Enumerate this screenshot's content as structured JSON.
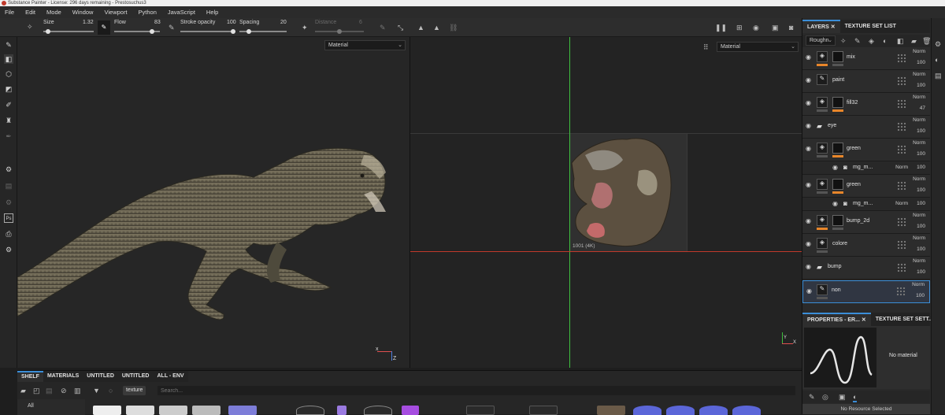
{
  "window": {
    "title": "Substance Painter - License: 296 days remaining - Prestosuchus3"
  },
  "menu": [
    "File",
    "Edit",
    "Mode",
    "Window",
    "Viewport",
    "Python",
    "JavaScript",
    "Help"
  ],
  "toolbar": {
    "size_label": "Size",
    "size_value": "1.32",
    "size_level": 0.1,
    "flow_label": "Flow",
    "flow_value": "83",
    "flow_level": 0.83,
    "stroke_opacity_label": "Stroke opacity",
    "stroke_opacity_value": "100",
    "stroke_opacity_level": 1.0,
    "spacing_label": "Spacing",
    "spacing_value": "20",
    "spacing_level": 0.2,
    "distance_label": "Distance",
    "distance_value": "6",
    "distance_level": 0.5
  },
  "viewports": {
    "left_mode": "Material",
    "right_mode": "Material",
    "uv_tile_label": "1001 (4K)"
  },
  "layers_panel": {
    "tabs": [
      "LAYERS",
      "TEXTURE SET LIST"
    ],
    "channel": "Roughn",
    "layers": [
      {
        "name": "mix",
        "type": "fill",
        "blend": "Norm",
        "opacity": "100",
        "has_mask": true,
        "accent": "#e8862a"
      },
      {
        "name": "paint",
        "type": "paint",
        "blend": "Norm",
        "opacity": "100",
        "has_mask": false,
        "accent": ""
      },
      {
        "name": "fill32",
        "type": "fill",
        "blend": "Norm",
        "opacity": "47",
        "has_mask": true,
        "accent": "#e8862a"
      },
      {
        "name": "eye",
        "type": "folder",
        "blend": "Norm",
        "opacity": "100",
        "has_mask": false,
        "accent": ""
      },
      {
        "name": "green",
        "type": "fill",
        "blend": "Norm",
        "opacity": "100",
        "has_mask": true,
        "accent": "#e8862a"
      },
      {
        "name": "mg_m...",
        "type": "sub",
        "blend": "Norm",
        "opacity": "100",
        "has_mask": false,
        "accent": ""
      },
      {
        "name": "green",
        "type": "fill",
        "blend": "Norm",
        "opacity": "100",
        "has_mask": true,
        "accent": "#e8862a"
      },
      {
        "name": "mg_m...",
        "type": "sub",
        "blend": "Norm",
        "opacity": "100",
        "has_mask": false,
        "accent": ""
      },
      {
        "name": "bump_2d",
        "type": "fill",
        "blend": "Norm",
        "opacity": "100",
        "has_mask": true,
        "accent": "#e8862a"
      },
      {
        "name": "colore",
        "type": "fill",
        "blend": "Norm",
        "opacity": "100",
        "has_mask": false,
        "accent": ""
      },
      {
        "name": "bump",
        "type": "folder",
        "blend": "Norm",
        "opacity": "100",
        "has_mask": false,
        "accent": ""
      },
      {
        "name": "non",
        "type": "paint",
        "blend": "Norm",
        "opacity": "100",
        "has_mask": false,
        "accent": "",
        "selected": true
      }
    ]
  },
  "properties_panel": {
    "tabs": [
      "PROPERTIES - ER...",
      "TEXTURE SET SETT..."
    ],
    "material_text": "No material",
    "footer_text": "No Resource Selected"
  },
  "shelf": {
    "tabs": [
      "SHELF",
      "MATERIALS",
      "UNTITLED",
      "UNTITLED",
      "ALL - ENV"
    ],
    "filter_tag": "texture",
    "search_placeholder": "Search...",
    "category": "All"
  },
  "colors": {
    "accent_blue": "#3b8ed8",
    "layer_accent_orange": "#e8862a",
    "uv_green": "#3fbf3f",
    "uv_red": "#c0392b"
  }
}
